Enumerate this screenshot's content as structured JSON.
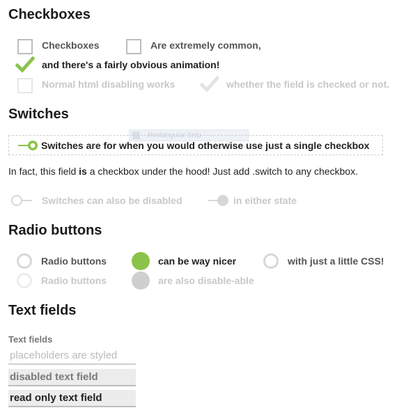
{
  "checkboxes": {
    "heading": "Checkboxes",
    "items": [
      {
        "label": "Checkboxes",
        "checked": false,
        "disabled": false
      },
      {
        "label": "Are extremely common,",
        "checked": false,
        "disabled": false
      },
      {
        "label": "and there's a fairly obvious animation!",
        "checked": true,
        "disabled": false
      },
      {
        "label": "Normal html disabling works",
        "checked": false,
        "disabled": true
      },
      {
        "label": "whether the field is checked or not.",
        "checked": true,
        "disabled": true
      }
    ]
  },
  "switches": {
    "heading": "Switches",
    "main_label": "Switches are for when you would otherwise use just a single checkbox",
    "ghost_tooltip": "Rectangular Snip",
    "info_before": "In fact, this field ",
    "info_bold": "is",
    "info_after": " a checkbox under the hood! Just add .switch to any checkbox.",
    "disabled_off_label": "Switches can also be disabled",
    "disabled_on_label": "in either state"
  },
  "radios": {
    "heading": "Radio buttons",
    "items": [
      {
        "label": "Radio buttons",
        "checked": false,
        "disabled": false
      },
      {
        "label": "can be way nicer",
        "checked": true,
        "disabled": false
      },
      {
        "label": "with just a little CSS!",
        "checked": false,
        "disabled": false
      },
      {
        "label": "Radio buttons",
        "checked": false,
        "disabled": true
      },
      {
        "label": "are also disable-able",
        "checked": true,
        "disabled": true
      }
    ]
  },
  "text_fields": {
    "heading": "Text fields",
    "label": "Text fields",
    "placeholder": "placeholders are styled",
    "disabled_value": "disabled text field",
    "readonly_value": "read only text field"
  },
  "colors": {
    "accent": "#8bc34a",
    "disabled": "#cfcfcf"
  }
}
